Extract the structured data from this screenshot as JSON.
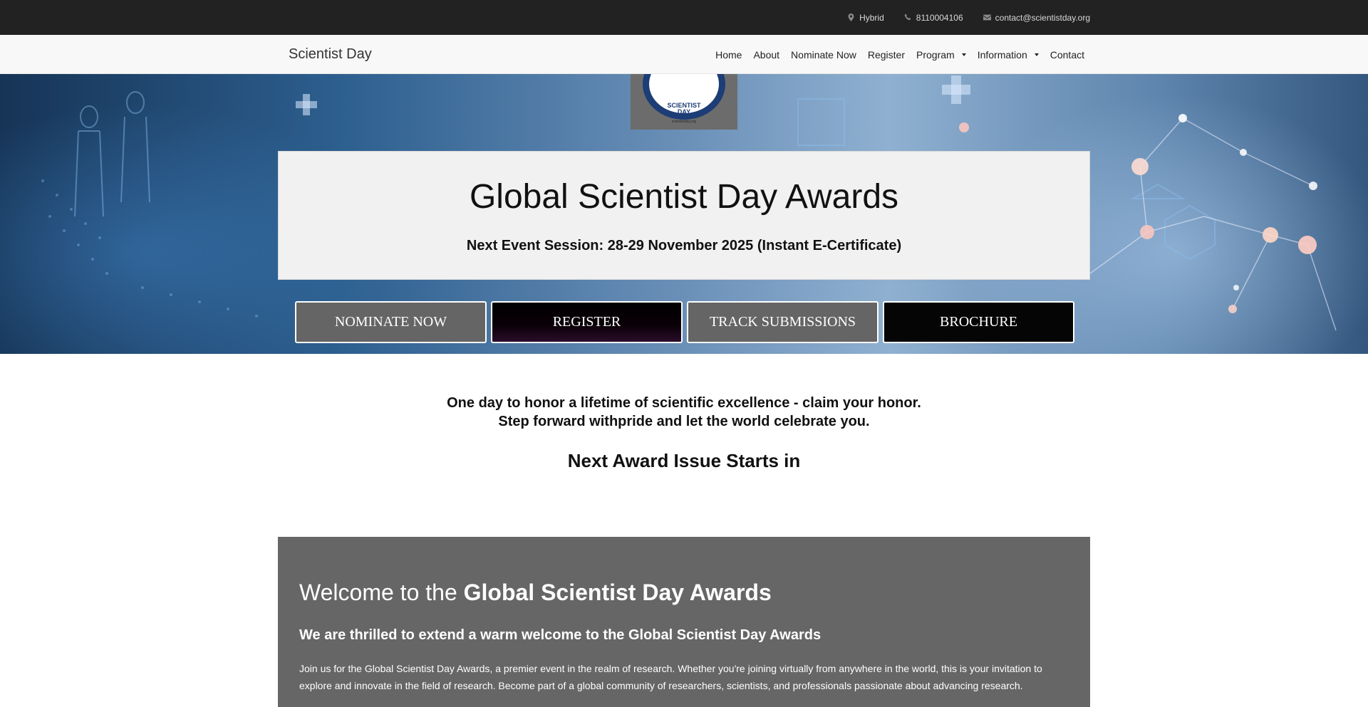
{
  "topbar": {
    "location": "Hybrid",
    "phone": "8110004106",
    "email": "contact@scientistday.org"
  },
  "nav": {
    "brand": "Scientist Day",
    "items": [
      {
        "label": "Home"
      },
      {
        "label": "About"
      },
      {
        "label": "Nominate Now"
      },
      {
        "label": "Register"
      },
      {
        "label": "Program"
      },
      {
        "label": "Information"
      },
      {
        "label": "Contact"
      }
    ]
  },
  "logo": {
    "line1": "SCIENTIST",
    "line2": "DAY",
    "url": "scientistday.org"
  },
  "hero": {
    "title": "Global Scientist Day Awards",
    "session": "Next Event Session: 28-29 November 2025 (Instant E-Certificate)",
    "buttons": {
      "nominate": "NOMINATE NOW",
      "register": "REGISTER",
      "track": "TRACK SUBMISSIONS",
      "brochure": "BROCHURE"
    }
  },
  "intro": {
    "line1": "One day to honor a lifetime of scientific excellence - claim your honor.",
    "line2": "Step forward withpride and let the world celebrate you.",
    "countdown_title": "Next Award Issue Starts in"
  },
  "welcome": {
    "heading_prefix": "Welcome to the",
    "heading_strong": "Global Scientist Day Awards",
    "subheading": "We are thrilled to extend a warm welcome to the Global Scientist Day Awards",
    "body": "Join us for the Global Scientist Day Awards, a premier event in the realm of research. Whether you're joining virtually from anywhere in the world, this is your invitation to explore and innovate in the field of research. Become part of a global community of researchers, scientists, and professionals passionate about advancing research."
  },
  "colors": {
    "topbar_bg": "#222222",
    "navbar_bg": "#f8f8f8",
    "button_grey": "#656565",
    "button_black": "#050505",
    "welcome_bg": "#666666",
    "logo_ring": "#1c3d76"
  },
  "icons": {
    "location": "map-marker-icon",
    "phone": "phone-icon",
    "email": "envelope-icon"
  }
}
